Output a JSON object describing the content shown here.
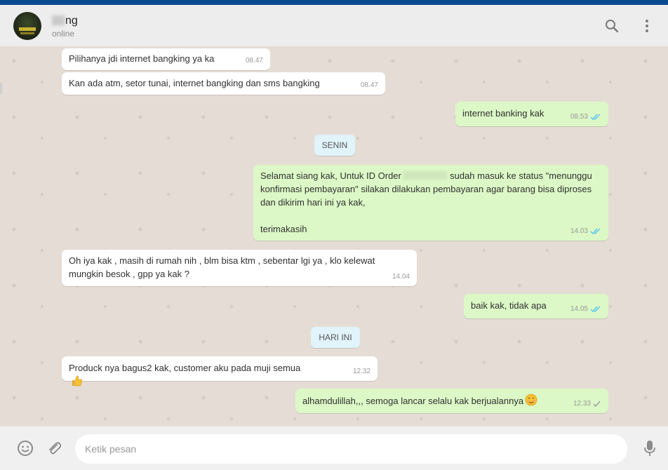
{
  "header": {
    "contact_name_visible": "ng",
    "status": "online",
    "icons": {
      "search": "search-icon",
      "menu": "kebab-menu-icon"
    }
  },
  "messages": [
    {
      "dir": "in",
      "text": "Pilihanya jdi internet bangking ya ka",
      "time": "08.47"
    },
    {
      "dir": "in",
      "text": "Kan ada atm, setor tunai, internet bangking dan sms bangking",
      "time": "08.47"
    },
    {
      "dir": "out",
      "text": "internet banking kak",
      "time": "08.53",
      "ticks": "read"
    },
    {
      "dir": "out",
      "text_before": "Selamat siang kak, Untuk ID Order",
      "text_after": "sudah masuk ke status \"menunggu konfirmasi pembayaran\" silakan dilakukan pembayaran agar barang bisa diproses dan dikirim hari ini ya kak,\n\nterimakasih",
      "time": "14.03",
      "ticks": "read"
    },
    {
      "dir": "in",
      "text": "Oh iya kak , masih di rumah nih , blm bisa ktm , sebentar lgi ya , klo kelewat mungkin besok , gpp ya kak ?",
      "time": "14.04"
    },
    {
      "dir": "out",
      "text": "baik kak, tidak apa",
      "time": "14.05",
      "ticks": "read"
    },
    {
      "dir": "in",
      "text": "Produck nya bagus2 kak, customer aku pada muji semua",
      "time": "12.32",
      "emoji": "thumbs-up"
    },
    {
      "dir": "out",
      "text": "alhamdulillah,,, semoga lancar selalu kak berjualannya",
      "time": "12.33",
      "ticks": "sent",
      "emoji": "smiling-face"
    }
  ],
  "date_chips": {
    "senin": "SENIN",
    "hari_ini": "HARI INI"
  },
  "composer": {
    "placeholder": "Ketik pesan"
  },
  "colors": {
    "incoming": "#ffffff",
    "outgoing": "#dcf8c6",
    "chat_bg": "#e5ddd5",
    "read_ticks": "#4fc3f7",
    "top_stripe": "#0a4a8f"
  }
}
